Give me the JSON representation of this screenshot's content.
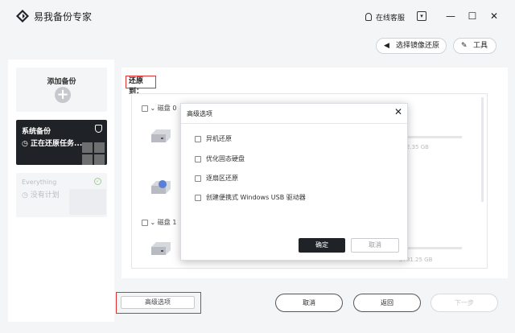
{
  "app": {
    "title": "易我备份专家"
  },
  "titlebar": {
    "service_label": "在线客服",
    "minimize": "—",
    "maximize": "☐",
    "close": "✕",
    "dropdown": "▾"
  },
  "top_buttons": {
    "select_image": "选择镜像还原",
    "tools": "工具"
  },
  "sidebar": {
    "add_backup": "添加备份",
    "system_backup": {
      "title": "系统备份",
      "status": "正在还原任务..."
    },
    "everything": {
      "title": "Everything",
      "status": "没有计划"
    }
  },
  "main": {
    "restore_to": "还原到：",
    "disks": [
      {
        "label": "磁盘 0",
        "size": "232.35 GB"
      },
      {
        "label": "磁盘 1",
        "size": "3781.25 GB"
      }
    ]
  },
  "modal": {
    "title": "高级选项",
    "close": "✕",
    "options": [
      "异机还原",
      "优化固态硬盘",
      "逐扇区还原",
      "创建便携式 Windows USB 驱动器"
    ],
    "ok": "确定",
    "cancel": "取消"
  },
  "footer": {
    "advanced": "高级选项",
    "cancel": "取消",
    "back": "返回",
    "next": "下一步"
  },
  "colors": {
    "highlight": "#e03030",
    "dark": "#1f2226",
    "background": "#f4f5f7"
  }
}
